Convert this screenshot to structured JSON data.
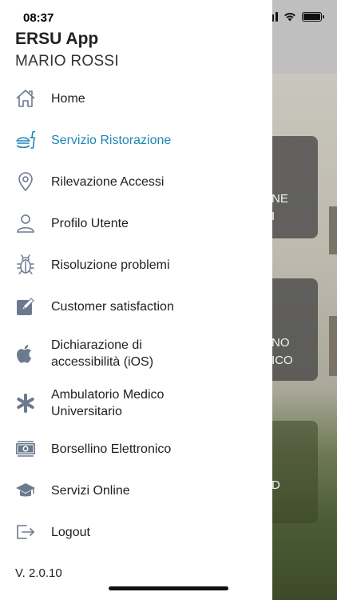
{
  "status_bar": {
    "time": "08:37"
  },
  "header": {
    "app_title": "ERSU App",
    "user_name": "MARIO ROSSI"
  },
  "menu": {
    "items": [
      {
        "label": "Home",
        "icon": "home-icon",
        "active": false
      },
      {
        "label": "Servizio Ristorazione",
        "icon": "restaurant-icon",
        "active": true
      },
      {
        "label": "Rilevazione Accessi",
        "icon": "location-pin-icon",
        "active": false
      },
      {
        "label": "Profilo Utente",
        "icon": "user-icon",
        "active": false
      },
      {
        "label": "Risoluzione problemi",
        "icon": "bug-icon",
        "active": false
      },
      {
        "label": "Customer satisfaction",
        "icon": "edit-icon",
        "active": false
      },
      {
        "label_line1": "Dichiarazione di",
        "label_line2": "accessibilità (iOS)",
        "icon": "apple-icon",
        "active": false
      },
      {
        "label_line1": "Ambulatorio Medico",
        "label_line2": "Universitario",
        "icon": "medical-asterisk-icon",
        "active": false
      },
      {
        "label": "Borsellino Elettronico",
        "icon": "money-icon",
        "active": false
      },
      {
        "label": "Servizi Online",
        "icon": "graduation-cap-icon",
        "active": false
      },
      {
        "label": "Logout",
        "icon": "logout-icon",
        "active": false
      }
    ]
  },
  "footer": {
    "version": "V. 2.0.10"
  },
  "background": {
    "card1_line1": "NE",
    "card1_line2": "I",
    "card2_line1": "NO",
    "card2_line2": "ICO",
    "card3_line1": "D"
  },
  "colors": {
    "accent": "#1f86b5",
    "icon": "#6b7a8f",
    "text": "#1f1f1f"
  }
}
